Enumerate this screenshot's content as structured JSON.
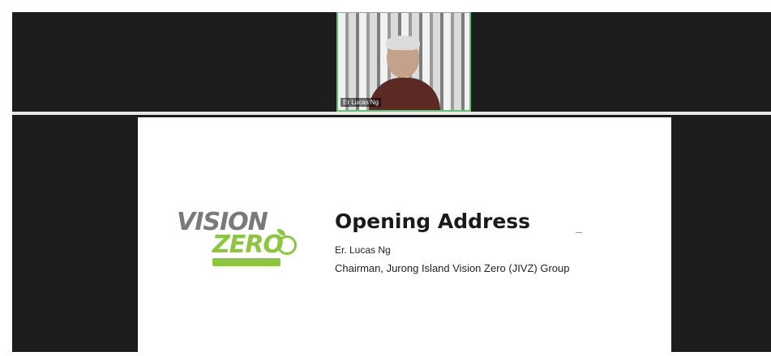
{
  "participant": {
    "name": "Er Lucas Ng"
  },
  "slide": {
    "logo_icon": "vision-zero-logo",
    "logo_line1": "VISION",
    "logo_line2": "ZERO",
    "title": "Opening Address",
    "speaker": "Er. Lucas Ng",
    "role": "Chairman, Jurong Island Vision Zero (JIVZ) Group"
  },
  "colors": {
    "brand_green": "#8cc63f",
    "brand_grey": "#7a7a7a",
    "active_speaker_border": "#5fc46a",
    "background": "#1c1c1c"
  }
}
